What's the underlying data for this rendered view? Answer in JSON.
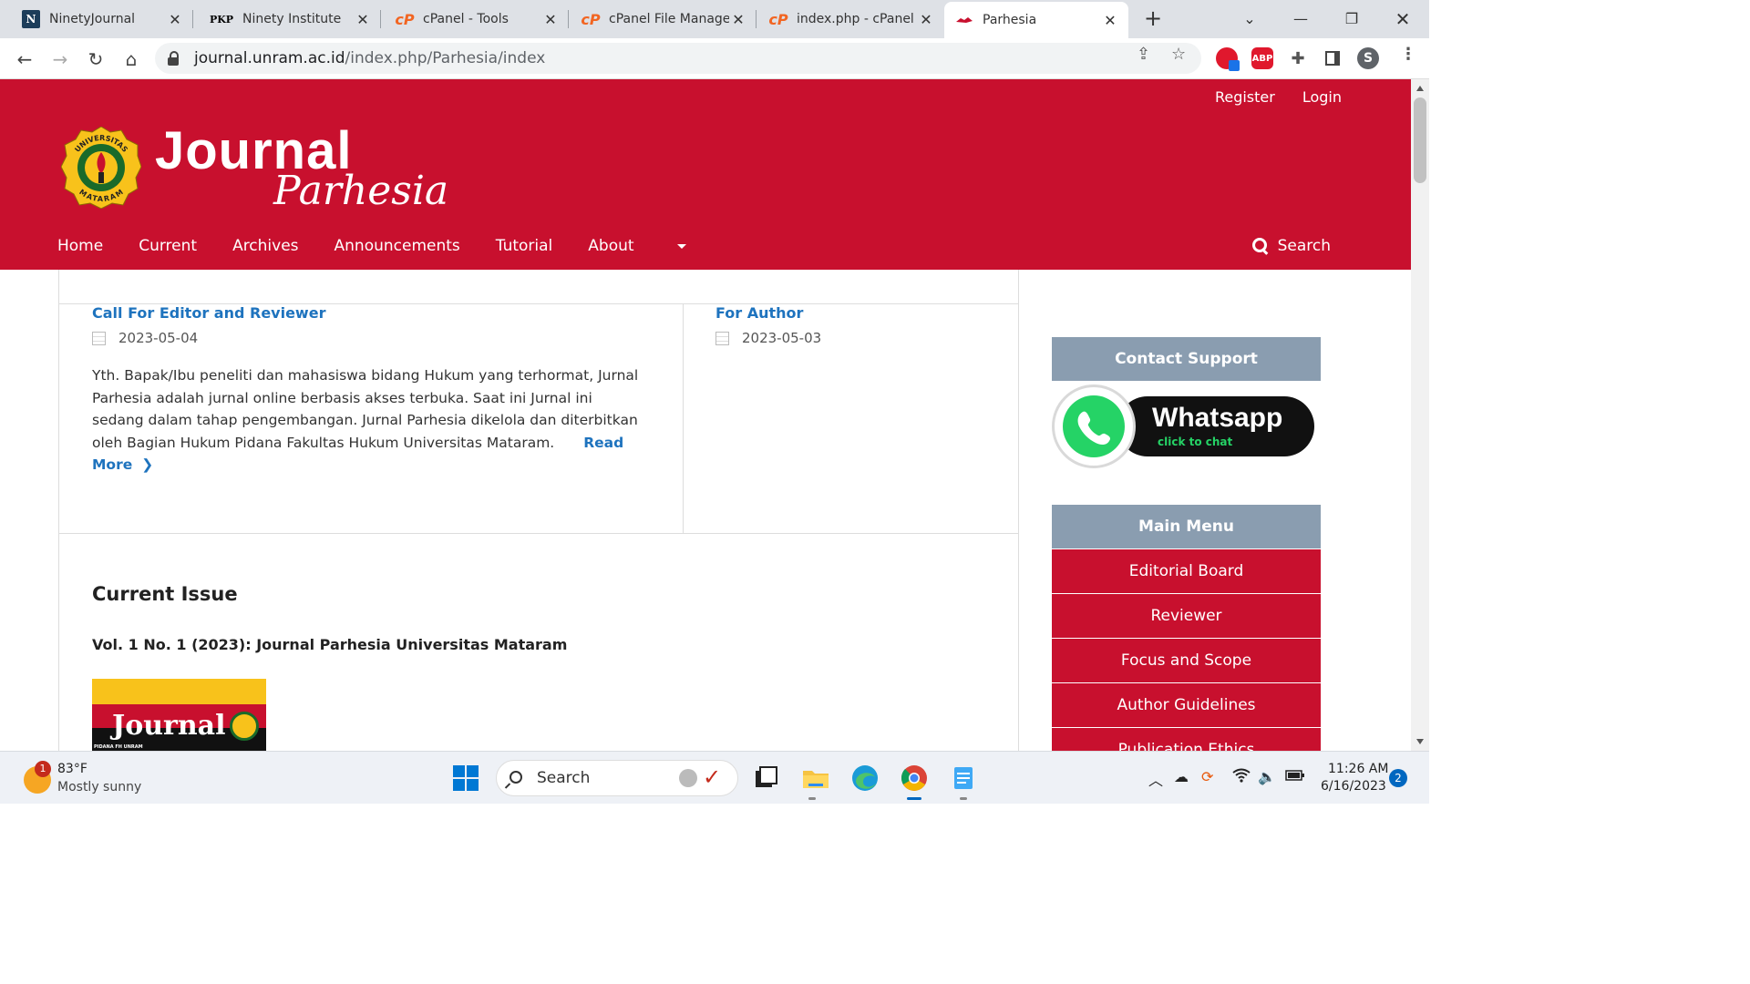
{
  "browser": {
    "tabs": [
      {
        "title": "NinetyJournal",
        "favicon": "N"
      },
      {
        "title": "Ninety Institute",
        "favicon": "PKP"
      },
      {
        "title": "cPanel - Tools",
        "favicon": "cP"
      },
      {
        "title": "cPanel File Manager",
        "favicon": "cP"
      },
      {
        "title": "index.php - cPanel File Manager",
        "favicon": "cP"
      },
      {
        "title": "Parhesia",
        "favicon": ""
      }
    ],
    "url_host": "journal.unram.ac.id",
    "url_path": "/index.php/Parhesia/index",
    "ext_abp": "ABP",
    "profile_initial": "S"
  },
  "header": {
    "register": "Register",
    "login": "Login",
    "logo_ring_top": "UNIVERSITAS",
    "logo_ring_bottom": "MATARAM",
    "brand_title": "Journal",
    "brand_sub": "Parhesia",
    "nav": [
      "Home",
      "Current",
      "Archives",
      "Announcements",
      "Tutorial",
      "About"
    ],
    "search": "Search",
    "brand_color": "#c8102e"
  },
  "announcements": [
    {
      "title": "Call For Editor and Reviewer",
      "date": "2023-05-04",
      "body": "Yth. Bapak/Ibu peneliti dan mahasiswa bidang Hukum yang terhormat, Jurnal Parhesia adalah jurnal online berbasis akses terbuka. Saat ini Jurnal ini sedang dalam tahap pengembangan. Jurnal Parhesia dikelola dan diterbitkan oleh Bagian Hukum Pidana Fakultas Hukum Universitas Mataram.",
      "read_more": "Read More"
    },
    {
      "title": "For Author",
      "date": "2023-05-03"
    }
  ],
  "current_issue": {
    "heading": "Current Issue",
    "title": "Vol. 1 No. 1 (2023): Journal Parhesia Universitas Mataram",
    "cover_title": "Journal",
    "cover_band": "PIDANA FH UNRAM"
  },
  "sidebar": {
    "contact_heading": "Contact Support",
    "whatsapp_label": "Whatsapp",
    "whatsapp_sub": "click to chat",
    "menu_heading": "Main Menu",
    "menu_items": [
      "Editorial Board",
      "Reviewer",
      "Focus and Scope",
      "Author Guidelines",
      "Publication Ethics"
    ]
  },
  "taskbar": {
    "weather_temp": "83°F",
    "weather_desc": "Mostly sunny",
    "weather_badge": "1",
    "search": "Search",
    "time": "11:26 AM",
    "date": "6/16/2023",
    "notifications": "2"
  }
}
